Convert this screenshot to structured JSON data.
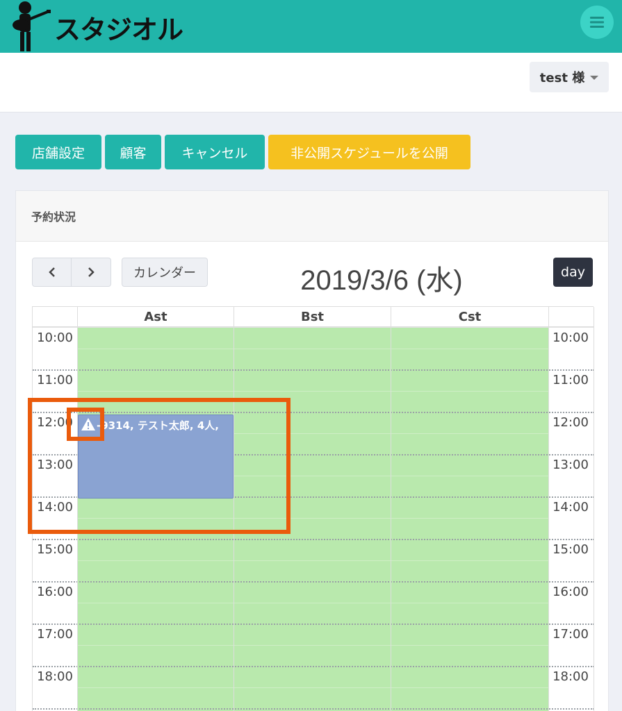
{
  "app": {
    "logo_text": "スタジオル"
  },
  "user": {
    "label": "test 様"
  },
  "actions": [
    {
      "label": "店舗設定"
    },
    {
      "label": "顧客"
    },
    {
      "label": "キャンセル"
    },
    {
      "label": "非公開スケジュールを公開"
    }
  ],
  "panel": {
    "title": "予約状況"
  },
  "calendar": {
    "prev_label": "<",
    "next_label": ">",
    "calendar_button": "カレンダー",
    "date_title": "2019/3/6 (水)",
    "view_button": "day",
    "columns": [
      "Ast",
      "Bst",
      "Cst"
    ],
    "times": [
      "10:00",
      "11:00",
      "12:00",
      "13:00",
      "14:00",
      "15:00",
      "16:00",
      "17:00",
      "18:00"
    ],
    "event": {
      "text": "-9314, テスト太郎, 4人,",
      "column": "Ast",
      "start": "12:00",
      "end": "14:00",
      "warning": true
    }
  },
  "colors": {
    "header": "#21b5aa",
    "accent_yellow": "#f5c11f",
    "available": "#b9e9ad",
    "event": "#8aa3d2",
    "highlight": "#ea5b0c"
  }
}
